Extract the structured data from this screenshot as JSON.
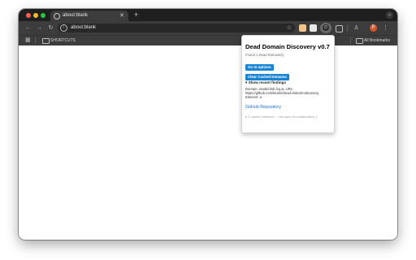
{
  "tab": {
    "title": "about:blank",
    "close_icon": "close-icon",
    "new_tab_label": "+"
  },
  "toolbar": {
    "back": "←",
    "forward": "→",
    "reload": "↻",
    "url": "about:blank",
    "star": "☆"
  },
  "extensions": {
    "profile_initial": "P",
    "menu": "⋮"
  },
  "bookmarks": {
    "folder_label": "SHORTCUTS",
    "all_bookmarks_label": "All Bookmarks"
  },
  "popup": {
    "title": "Dead Domain Discovery v0.7",
    "found_text": "Found 1 Dead Domain(s).",
    "options_button": "Go to options",
    "clear_button": "Clear Cached Domains",
    "recent_summary": "▾ Show recent findings",
    "finding_text": "Domain: invalid-link.fxq.ai, URL: https://github.com/lauritz/dead-domain-discovery, Element: a",
    "github_link": "GitHub Repository",
    "footer": "▸ © Lauritz Holtmann – I am open for collaboration :)"
  },
  "colors": {
    "accent_button": "#1a84d4",
    "link": "#1a6fd4",
    "chrome_dark": "#3c3c3c"
  }
}
